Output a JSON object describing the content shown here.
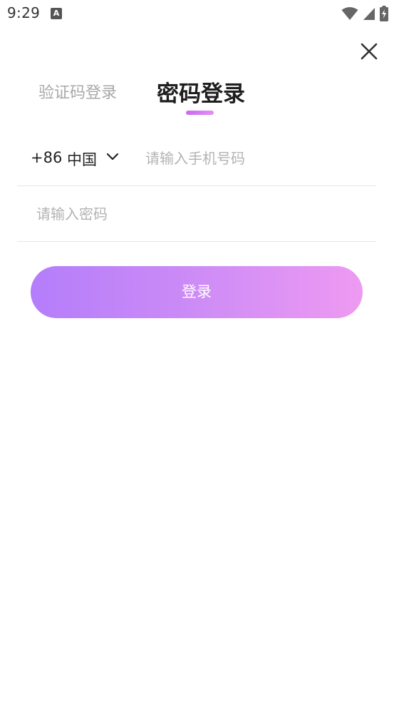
{
  "status_bar": {
    "time": "9:29",
    "notification_icon": "text-a-icon",
    "notification_glyph": "A",
    "icons": [
      "wifi-icon",
      "cell-signal-icon",
      "battery-charging-icon"
    ]
  },
  "header": {
    "close_icon": "close-icon"
  },
  "tabs": [
    {
      "label": "验证码登录",
      "active": false
    },
    {
      "label": "密码登录",
      "active": true
    }
  ],
  "form": {
    "country_code": "+86",
    "country_name": "中国",
    "country_chevron_icon": "chevron-down-icon",
    "phone_placeholder": "请输入手机号码",
    "phone_value": "",
    "password_placeholder": "请输入密码",
    "password_value": ""
  },
  "login_button": {
    "label": "登录"
  },
  "colors": {
    "active_tab": "#1e1e1e",
    "inactive_tab": "#a8a8a8",
    "indicator_start": "#c86bf0",
    "indicator_end": "#e38ff2",
    "button_start": "#b47dfa",
    "button_end": "#ee9af2",
    "divider": "#e6e6e6",
    "placeholder": "#b3b3b3"
  }
}
